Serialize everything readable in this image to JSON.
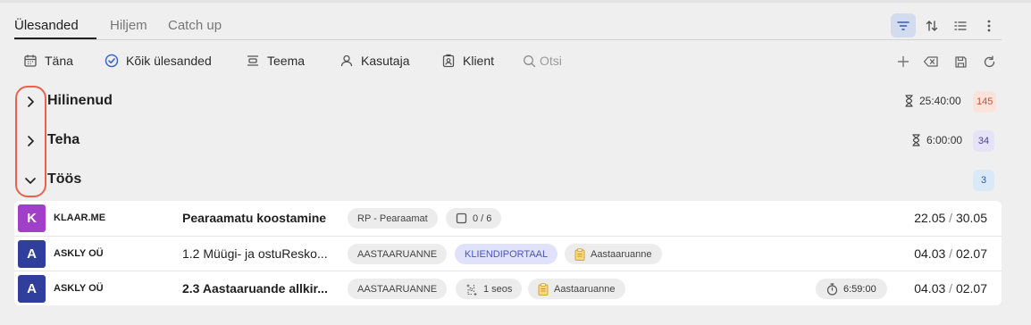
{
  "tabs": [
    {
      "label": "Ülesanded",
      "active": true
    },
    {
      "label": "Hiljem",
      "active": false
    },
    {
      "label": "Catch up",
      "active": false
    }
  ],
  "toolbar_icons": [
    "filter-icon",
    "sort-icon",
    "list-view-icon",
    "more-vertical-icon"
  ],
  "filters": {
    "today": "Täna",
    "all_tasks": "Kõik ülesanded",
    "topic": "Teema",
    "user": "Kasutaja",
    "client": "Klient",
    "search_placeholder": "Otsi"
  },
  "filter_actions": [
    "add-icon",
    "clear-filter-icon",
    "save-icon",
    "refresh-icon"
  ],
  "groups": [
    {
      "title": "Hilinenud",
      "time": "25:40:00",
      "count": "145",
      "expanded": false,
      "count_bg": "#fbe3dc",
      "count_fg": "#c0563b"
    },
    {
      "title": "Teha",
      "time": "6:00:00",
      "count": "34",
      "expanded": false,
      "count_bg": "#e6e3f8",
      "count_fg": "#4b44a0"
    },
    {
      "title": "Töös",
      "time": "",
      "count": "3",
      "expanded": true,
      "count_bg": "#d9e9f8",
      "count_fg": "#2b5f9a"
    }
  ],
  "tasks": [
    {
      "avatar": "K",
      "avatar_color": "#a03fc8",
      "client": "KLAAR.ME",
      "name": "Pearaamatu koostamine",
      "tags": [
        "RP - Pearaamat",
        "0 / 6"
      ],
      "start": "22.05",
      "end": "30.05"
    },
    {
      "avatar": "A",
      "avatar_color": "#2f3f9b",
      "client": "ASKLY OÜ",
      "name": "1.2 Müügi- ja ostuResko...",
      "tags": [
        "AASTAARUANNE",
        "KLIENDIPORTAAL",
        "Aastaaruanne"
      ],
      "start": "04.03",
      "end": "02.07"
    },
    {
      "avatar": "A",
      "avatar_color": "#2f3f9b",
      "client": "ASKLY OÜ",
      "name": "2.3 Aastaaruande allkir...",
      "tags": [
        "AASTAARUANNE",
        "1 seos",
        "Aastaaruanne"
      ],
      "timer": "6:59:00",
      "start": "04.03",
      "end": "02.07"
    }
  ],
  "accent_color": "#e8624d"
}
